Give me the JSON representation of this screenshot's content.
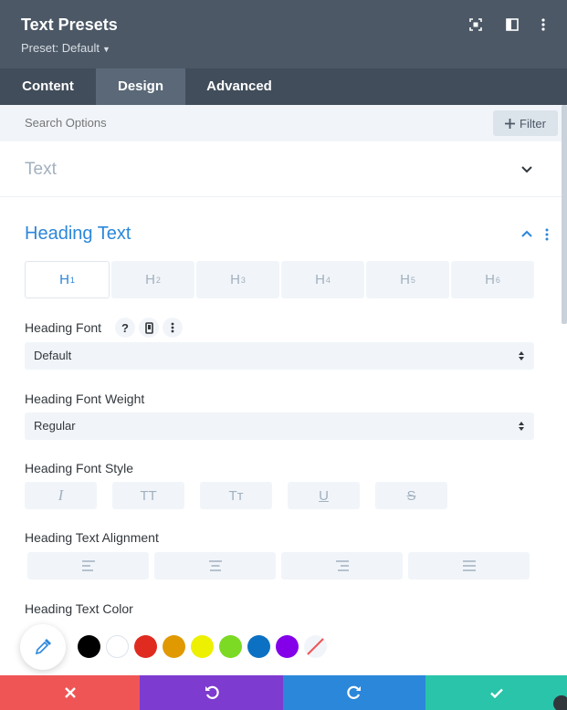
{
  "header": {
    "title": "Text Presets",
    "preset_label": "Preset: Default"
  },
  "tabs": [
    {
      "label": "Content",
      "active": false
    },
    {
      "label": "Design",
      "active": true
    },
    {
      "label": "Advanced",
      "active": false
    }
  ],
  "search": {
    "placeholder": "Search Options",
    "filter_label": "Filter"
  },
  "sections": {
    "text": {
      "label": "Text"
    },
    "heading": {
      "label": "Heading Text"
    }
  },
  "heading_tabs": [
    {
      "letter": "H",
      "num": "1",
      "active": true
    },
    {
      "letter": "H",
      "num": "2",
      "active": false
    },
    {
      "letter": "H",
      "num": "3",
      "active": false
    },
    {
      "letter": "H",
      "num": "4",
      "active": false
    },
    {
      "letter": "H",
      "num": "5",
      "active": false
    },
    {
      "letter": "H",
      "num": "6",
      "active": false
    }
  ],
  "fields": {
    "font": {
      "label": "Heading Font",
      "value": "Default"
    },
    "weight": {
      "label": "Heading Font Weight",
      "value": "Regular"
    },
    "style": {
      "label": "Heading Font Style",
      "buttons": [
        "I",
        "TT",
        "Tт",
        "U",
        "S"
      ]
    },
    "alignment": {
      "label": "Heading Text Alignment"
    },
    "color": {
      "label": "Heading Text Color"
    }
  },
  "swatches": [
    "#000000",
    "#ffffff",
    "#e02b20",
    "#e09900",
    "#edf000",
    "#7cda24",
    "#0c71c3",
    "#8300e9"
  ],
  "colors": {
    "accent": "#2b87da",
    "header_bg": "#4c5866",
    "cancel": "#ef5555",
    "undo": "#7e3bd0",
    "redo": "#2b87da",
    "save": "#29c4a9"
  }
}
